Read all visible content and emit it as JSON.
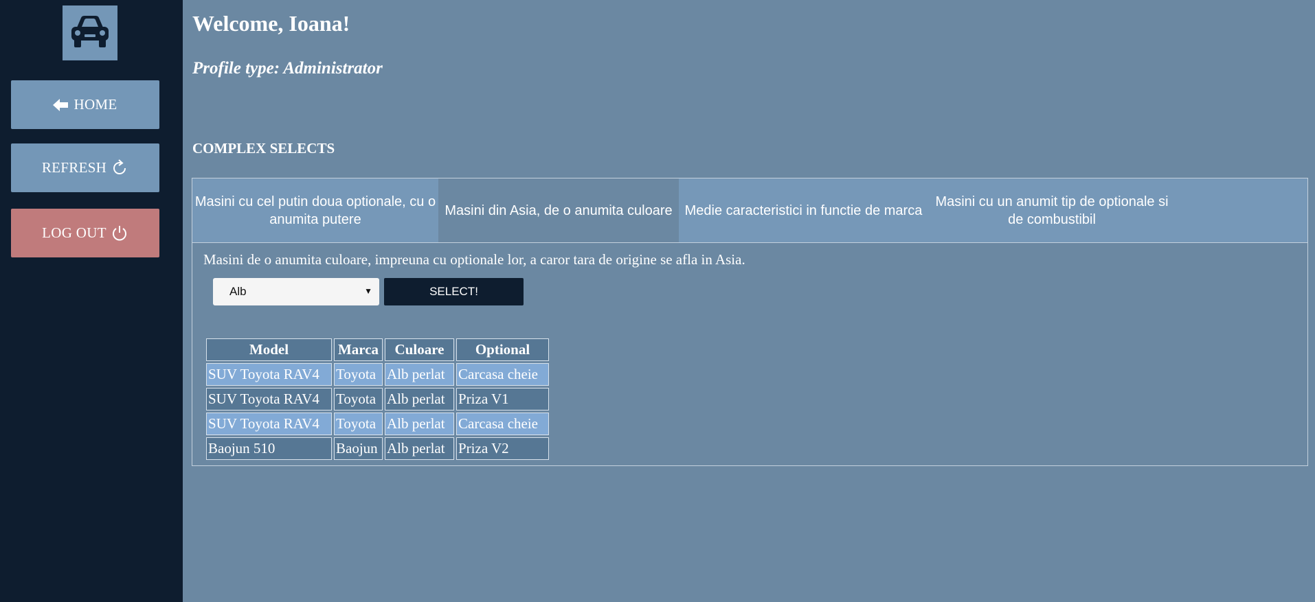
{
  "sidebar": {
    "logo_icon": "car-icon",
    "home_label": "HOME",
    "home_icon": "arrow-left-icon",
    "refresh_label": "REFRESH",
    "refresh_icon": "refresh-icon",
    "logout_label": "LOG OUT",
    "logout_icon": "power-icon"
  },
  "header": {
    "welcome": "Welcome, Ioana!",
    "profile": "Profile type: Administrator"
  },
  "section_title": "COMPLEX SELECTS",
  "tabs": [
    {
      "label": "Masini cu cel putin doua optionale, cu o anumita putere",
      "active": false
    },
    {
      "label": "Masini din Asia, de o anumita culoare",
      "active": true
    },
    {
      "label": "Medie caracteristici in functie de marca",
      "active": false
    },
    {
      "label": "Masini cu un anumit tip de optionale si de combustibil",
      "active": false
    }
  ],
  "query": {
    "description": "Masini de o anumita culoare, impreuna cu optionale lor, a caror tara de origine se afla in Asia.",
    "color_selected": "Alb",
    "select_button": "SELECT!"
  },
  "table": {
    "headers": [
      "Model",
      "Marca",
      "Culoare",
      "Optional"
    ],
    "rows": [
      [
        "SUV Toyota RAV4",
        "Toyota",
        "Alb perlat",
        "Carcasa cheie"
      ],
      [
        "SUV Toyota RAV4",
        "Toyota",
        "Alb perlat",
        "Priza V1"
      ],
      [
        "SUV Toyota RAV4",
        "Toyota",
        "Alb perlat",
        "Carcasa cheie"
      ],
      [
        "Baojun 510",
        "Baojun",
        "Alb perlat",
        "Priza V2"
      ]
    ]
  },
  "colors": {
    "sidebar_bg": "#0e1d2f",
    "main_bg": "#6b88a2",
    "button_blue": "#7497b7",
    "logout_red": "#c07b7c",
    "row_highlight": "#82aad6",
    "row_dark": "#567794"
  }
}
